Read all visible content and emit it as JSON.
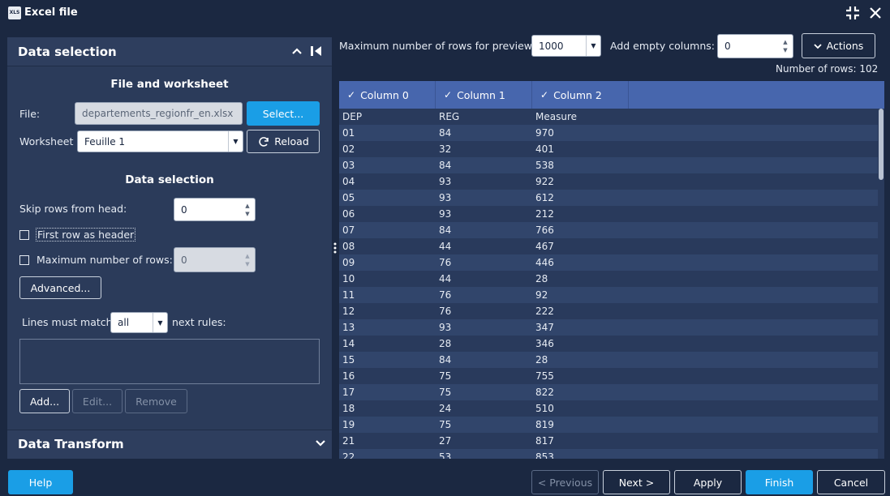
{
  "window": {
    "icon_text": "XLS",
    "title": "Excel file"
  },
  "left": {
    "data_selection_header": "Data selection",
    "file_section_title": "File and worksheet",
    "file_label": "File:",
    "file_value": "departements_regionfr_en.xlsx",
    "select_button": "Select...",
    "worksheet_label": "Worksheet",
    "worksheet_value": "Feuille 1",
    "reload_button": "Reload",
    "data_section_title": "Data selection",
    "skip_rows_label": "Skip rows from head:",
    "skip_rows_value": "0",
    "first_row_header_label": "First row as header",
    "max_rows_label": "Maximum number of rows:",
    "max_rows_value": "0",
    "advanced_button": "Advanced...",
    "lines_match_label": "Lines must match",
    "lines_match_value": "all",
    "next_rules_label": "next rules:",
    "add_button": "Add...",
    "edit_button": "Edit...",
    "remove_button": "Remove",
    "data_transform_header": "Data Transform"
  },
  "right": {
    "preview_rows_label": "Maximum number of rows for preview:",
    "preview_rows_value": "1000",
    "add_empty_label": "Add empty columns:",
    "add_empty_value": "0",
    "actions_button": "Actions",
    "rows_count": "Number of rows: 102"
  },
  "table": {
    "columns": [
      "Column 0",
      "Column 1",
      "Column 2"
    ],
    "rows": [
      [
        "DEP",
        "REG",
        "Measure"
      ],
      [
        "01",
        "84",
        "970"
      ],
      [
        "02",
        "32",
        "401"
      ],
      [
        "03",
        "84",
        "538"
      ],
      [
        "04",
        "93",
        "922"
      ],
      [
        "05",
        "93",
        "612"
      ],
      [
        "06",
        "93",
        "212"
      ],
      [
        "07",
        "84",
        "766"
      ],
      [
        "08",
        "44",
        "467"
      ],
      [
        "09",
        "76",
        "446"
      ],
      [
        "10",
        "44",
        "28"
      ],
      [
        "11",
        "76",
        "92"
      ],
      [
        "12",
        "76",
        "222"
      ],
      [
        "13",
        "93",
        "347"
      ],
      [
        "14",
        "28",
        "346"
      ],
      [
        "15",
        "84",
        "28"
      ],
      [
        "16",
        "75",
        "755"
      ],
      [
        "17",
        "75",
        "822"
      ],
      [
        "18",
        "24",
        "510"
      ],
      [
        "19",
        "75",
        "819"
      ],
      [
        "21",
        "27",
        "817"
      ],
      [
        "22",
        "53",
        "853"
      ]
    ]
  },
  "footer": {
    "help": "Help",
    "previous": "< Previous",
    "next": "Next >",
    "apply": "Apply",
    "finish": "Finish",
    "cancel": "Cancel"
  },
  "colors": {
    "background": "#1b2841",
    "panel": "#2b3b5a",
    "accent": "#1a9ee6",
    "table_header": "#4766ad"
  }
}
